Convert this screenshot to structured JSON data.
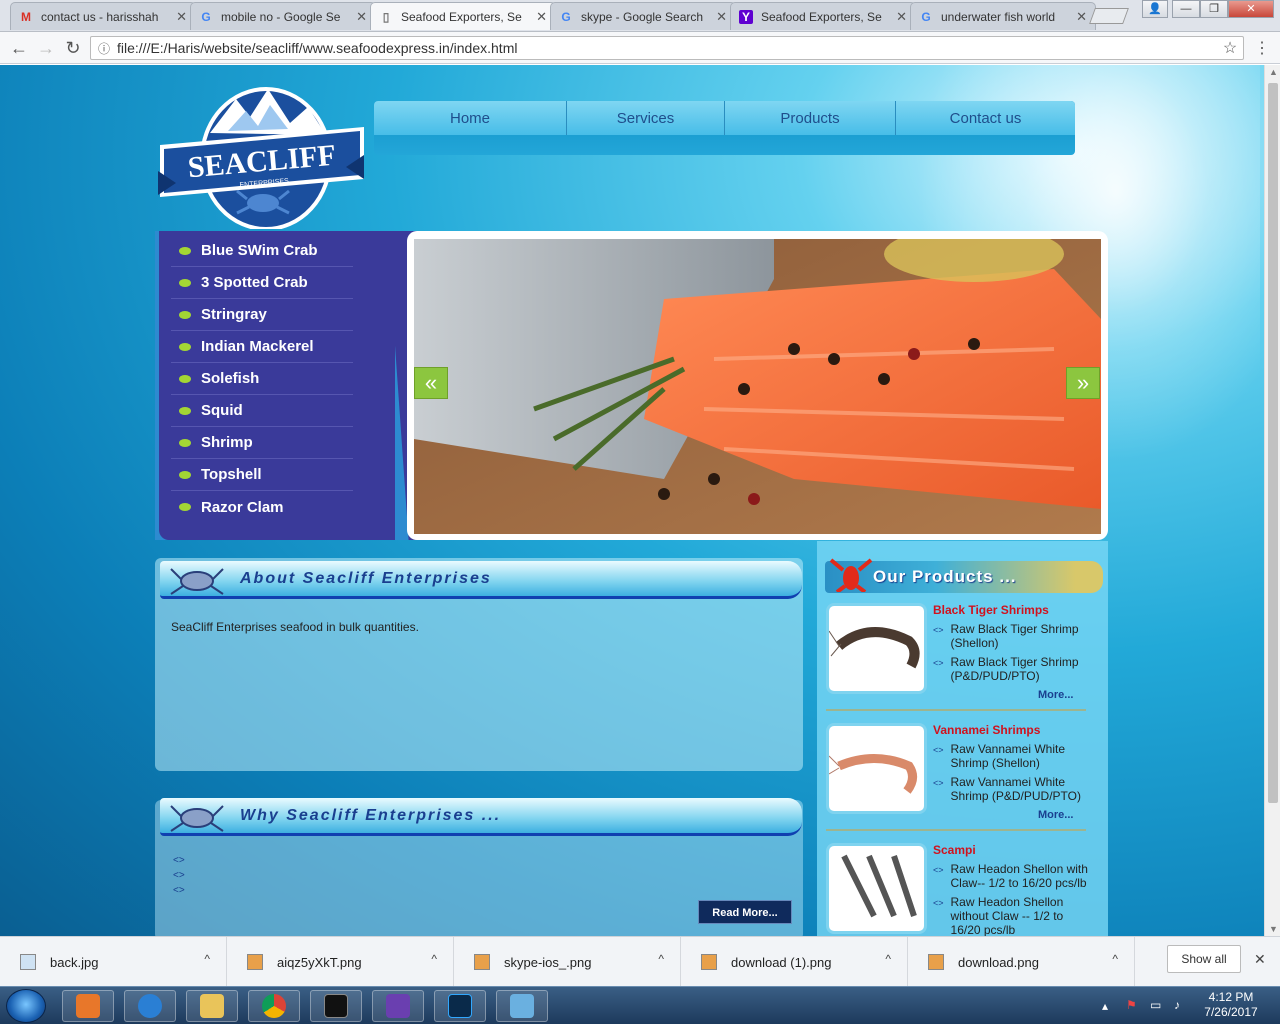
{
  "browser": {
    "tabs": [
      {
        "title": "contact us - harisshah",
        "favicon": "gmail-icon",
        "active": false
      },
      {
        "title": "mobile no - Google Se",
        "favicon": "google-icon",
        "active": false
      },
      {
        "title": "Seafood Exporters, Se",
        "favicon": "page-icon",
        "active": true
      },
      {
        "title": "skype - Google Search",
        "favicon": "google-icon",
        "active": false
      },
      {
        "title": "Seafood Exporters, Se",
        "favicon": "yahoo-icon",
        "active": false
      },
      {
        "title": "underwater fish world",
        "favicon": "google-icon",
        "active": false
      }
    ],
    "url": "file:///E:/Haris/website/seacliff/www.seafoodexpress.in/index.html"
  },
  "site": {
    "logo_text": "SEACLIFF",
    "logo_sub": "ENTERPRISES",
    "nav": [
      "Home",
      "Services",
      "Products",
      "Contact us"
    ],
    "side_menu": [
      "Blue SWim Crab",
      "3 Spotted Crab",
      "Stringray",
      "Indian Mackerel",
      "Solefish",
      "Squid",
      "Shrimp",
      "Topshell",
      "Razor Clam"
    ],
    "slider_prev": "«",
    "slider_next": "»",
    "about": {
      "heading": "About Seacliff Enterprises",
      "text": "SeaCliff Enterprises seafood in bulk quantities."
    },
    "why": {
      "heading": "Why Seacliff Enterprises ...",
      "read_more": "Read More..."
    },
    "products": {
      "heading": "Our Products ...",
      "items": [
        {
          "name": "Black Tiger Shrimps",
          "lines": [
            "Raw Black Tiger Shrimp (Shellon)",
            "Raw Black Tiger Shrimp (P&D/PUD/PTO)"
          ],
          "more": "More..."
        },
        {
          "name": "Vannamei Shrimps",
          "lines": [
            "Raw Vannamei White Shrimp (Shellon)",
            "Raw Vannamei White Shrimp (P&D/PUD/PTO)"
          ],
          "more": "More..."
        },
        {
          "name": "Scampi",
          "lines": [
            "Raw Headon Shellon with Claw-- 1/2 to 16/20 pcs/lb",
            "Raw Headon Shellon without Claw -- 1/2 to 16/20 pcs/lb"
          ],
          "more": ""
        }
      ]
    }
  },
  "downloads": {
    "items": [
      "back.jpg",
      "aiqz5yXkT.png",
      "skype-ios_.png",
      "download (1).png",
      "download.png"
    ],
    "show_all": "Show all"
  },
  "taskbar": {
    "time": "4:12 PM",
    "date": "7/26/2017"
  },
  "colors": {
    "side_menu_bg": "#3a3a9a",
    "bullet": "#a3d634",
    "product_name": "#d0121e",
    "heading_text": "#1a3f8f",
    "slider_arrow": "#8cc63f"
  }
}
